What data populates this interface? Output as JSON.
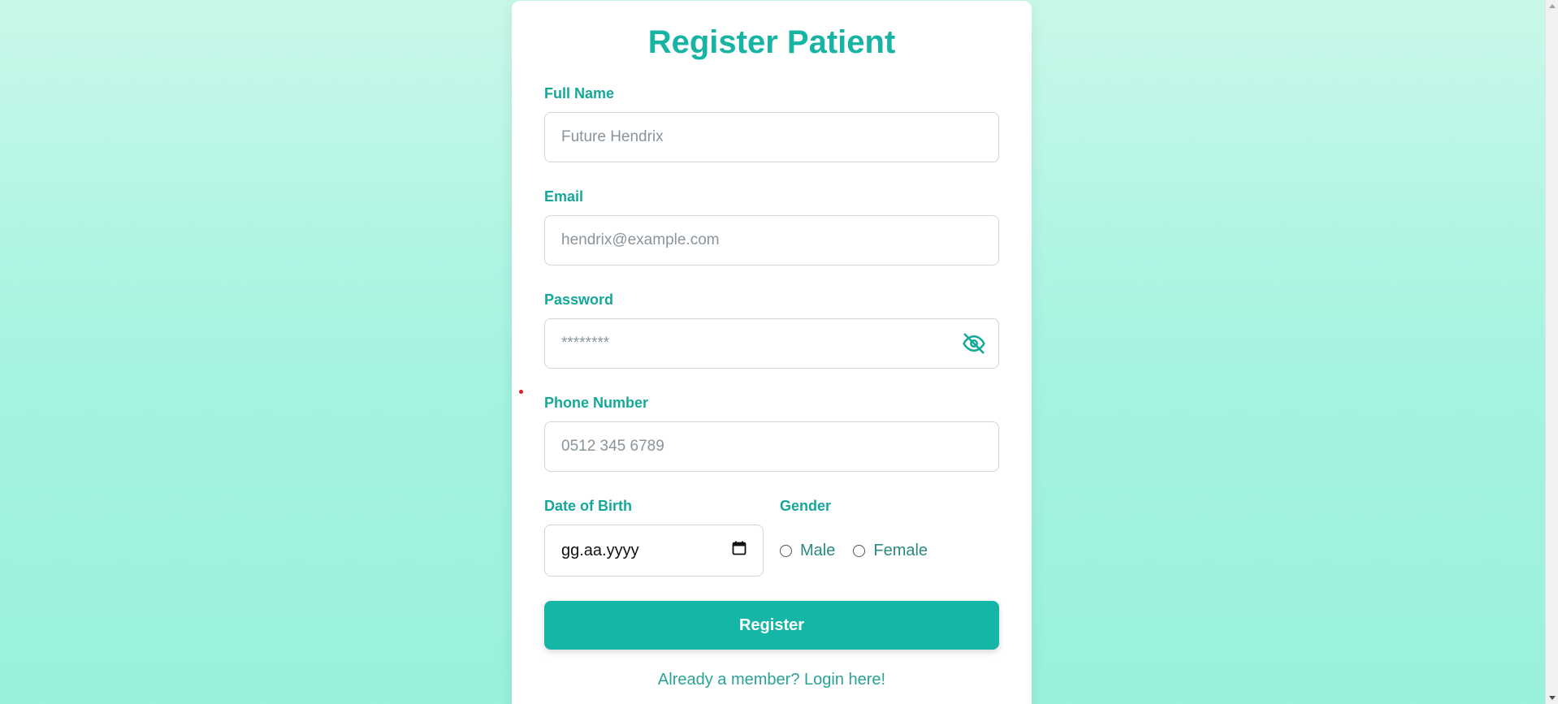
{
  "form": {
    "title": "Register Patient",
    "full_name": {
      "label": "Full Name",
      "placeholder": "Future Hendrix",
      "value": ""
    },
    "email": {
      "label": "Email",
      "placeholder": "hendrix@example.com",
      "value": ""
    },
    "password": {
      "label": "Password",
      "placeholder": "********",
      "value": "",
      "toggle_icon": "eye-off-icon"
    },
    "phone": {
      "label": "Phone Number",
      "placeholder": "0512 345 6789",
      "value": ""
    },
    "dob": {
      "label": "Date of Birth",
      "value": "gg.aa.yyyy",
      "icon": "calendar-icon"
    },
    "gender": {
      "label": "Gender",
      "options": [
        {
          "label": "Male"
        },
        {
          "label": "Female"
        }
      ]
    },
    "submit_label": "Register",
    "login_link": "Already a member? Login here!"
  },
  "colors": {
    "accent": "#15b6a6",
    "label": "#15a899",
    "background_top": "#c9f8ea",
    "background_bottom": "#98f1dd"
  }
}
